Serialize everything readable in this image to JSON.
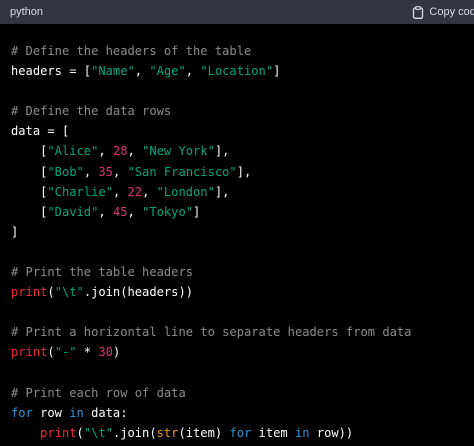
{
  "header": {
    "language": "python",
    "copy_label": "Copy code"
  },
  "code": {
    "l1": "# Define the headers of the table",
    "l2": {
      "a": "headers = [",
      "s1": "\"Name\"",
      "c1": ", ",
      "s2": "\"Age\"",
      "c2": ", ",
      "s3": "\"Location\"",
      "e": "]"
    },
    "l4": "# Define the data rows",
    "l5": "data = [",
    "rows": [
      {
        "indent": "    [",
        "name": "\"Alice\"",
        "sep1": ", ",
        "age": "28",
        "sep2": ", ",
        "city": "\"New York\"",
        "end": "],"
      },
      {
        "indent": "    [",
        "name": "\"Bob\"",
        "sep1": ", ",
        "age": "35",
        "sep2": ", ",
        "city": "\"San Francisco\"",
        "end": "],"
      },
      {
        "indent": "    [",
        "name": "\"Charlie\"",
        "sep1": ", ",
        "age": "22",
        "sep2": ", ",
        "city": "\"London\"",
        "end": "],"
      },
      {
        "indent": "    [",
        "name": "\"David\"",
        "sep1": ", ",
        "age": "45",
        "sep2": ", ",
        "city": "\"Tokyo\"",
        "end": "]"
      }
    ],
    "l10": "]",
    "l12": "# Print the table headers",
    "l13": {
      "fn": "print",
      "a": "(",
      "s": "\"\\t\"",
      "b": ".join(headers))"
    },
    "l15": "# Print a horizontal line to separate headers from data",
    "l16": {
      "fn": "print",
      "a": "(",
      "s": "\"-\"",
      "b": " * ",
      "n": "30",
      "c": ")"
    },
    "l18": "# Print each row of data",
    "l19": {
      "kw1": "for",
      "a": " row ",
      "kw2": "in",
      "b": " data:"
    },
    "l20": {
      "indent": "    ",
      "fn": "print",
      "a": "(",
      "s": "\"\\t\"",
      "b": ".join(",
      "bi": "str",
      "c": "(item) ",
      "kw1": "for",
      "d": " item ",
      "kw2": "in",
      "e": " row))"
    }
  },
  "colors": {
    "background": "#000000",
    "header_bar": "#343541",
    "comment": "#8c8c8c",
    "string": "#00a67d",
    "number": "#df3079",
    "keyword": "#2e95d3",
    "function": "#f22c3d",
    "builtin": "#e9950c"
  },
  "icons": {
    "copy": "clipboard-icon"
  }
}
